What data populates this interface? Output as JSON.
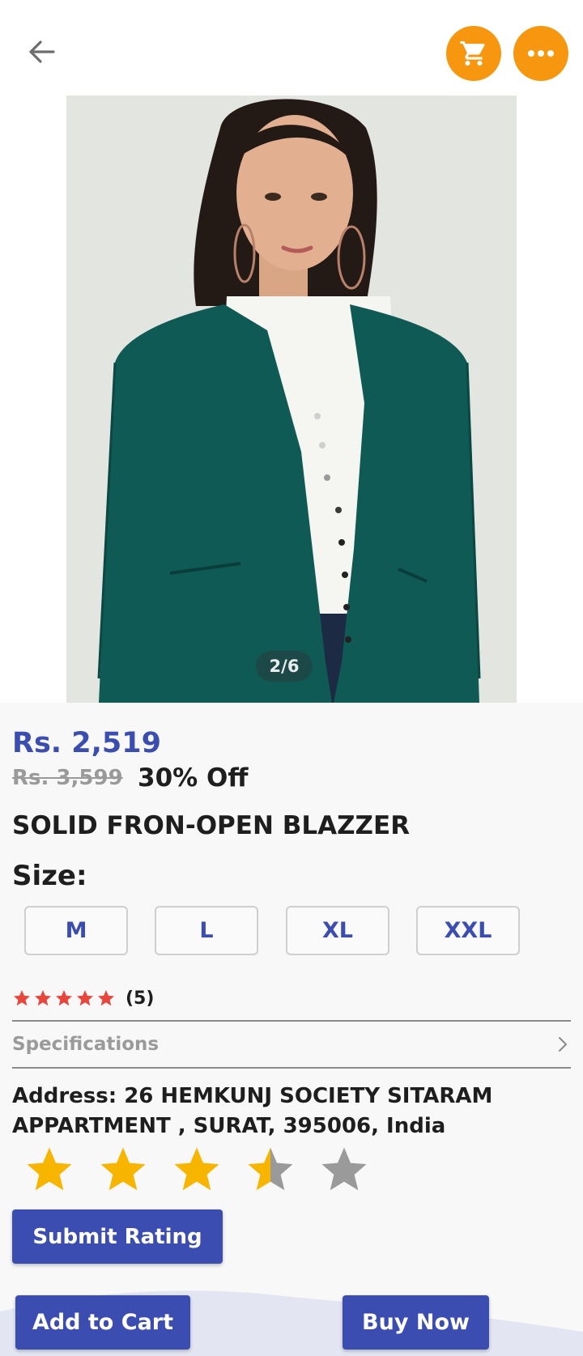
{
  "header": {
    "back_icon": "arrow-left-icon",
    "cart_icon": "shopping-cart-icon",
    "more_icon": "more-horizontal-icon",
    "accent_color": "#f7960f"
  },
  "gallery": {
    "pager": "2/6",
    "current_index": 2,
    "total": 6
  },
  "product": {
    "price": "Rs.  2,519",
    "original_price": "Rs. 3,599",
    "discount": "30% Off",
    "title": "SOLID FRON-OPEN BLAZZER",
    "size_label": "Size:",
    "sizes": [
      "M",
      "L",
      "XL",
      "XXL"
    ],
    "rating_stars": 5,
    "rating_count": "(5)",
    "rating_color": "#e8453c"
  },
  "specifications": {
    "label": "Specifications",
    "chevron_icon": "chevron-right-icon"
  },
  "address": {
    "text": "Address: 26 HEMKUNJ SOCIETY SITARAM APPARTMENT , SURAT, 395006, India"
  },
  "user_rating": {
    "value": 3.5,
    "max": 5,
    "filled_color": "#f7b500",
    "empty_color": "#9a9a9a",
    "submit_label": "Submit Rating"
  },
  "actions": {
    "add_to_cart": "Add to Cart",
    "buy_now": "Buy Now",
    "brand_color": "#3b4db0"
  }
}
